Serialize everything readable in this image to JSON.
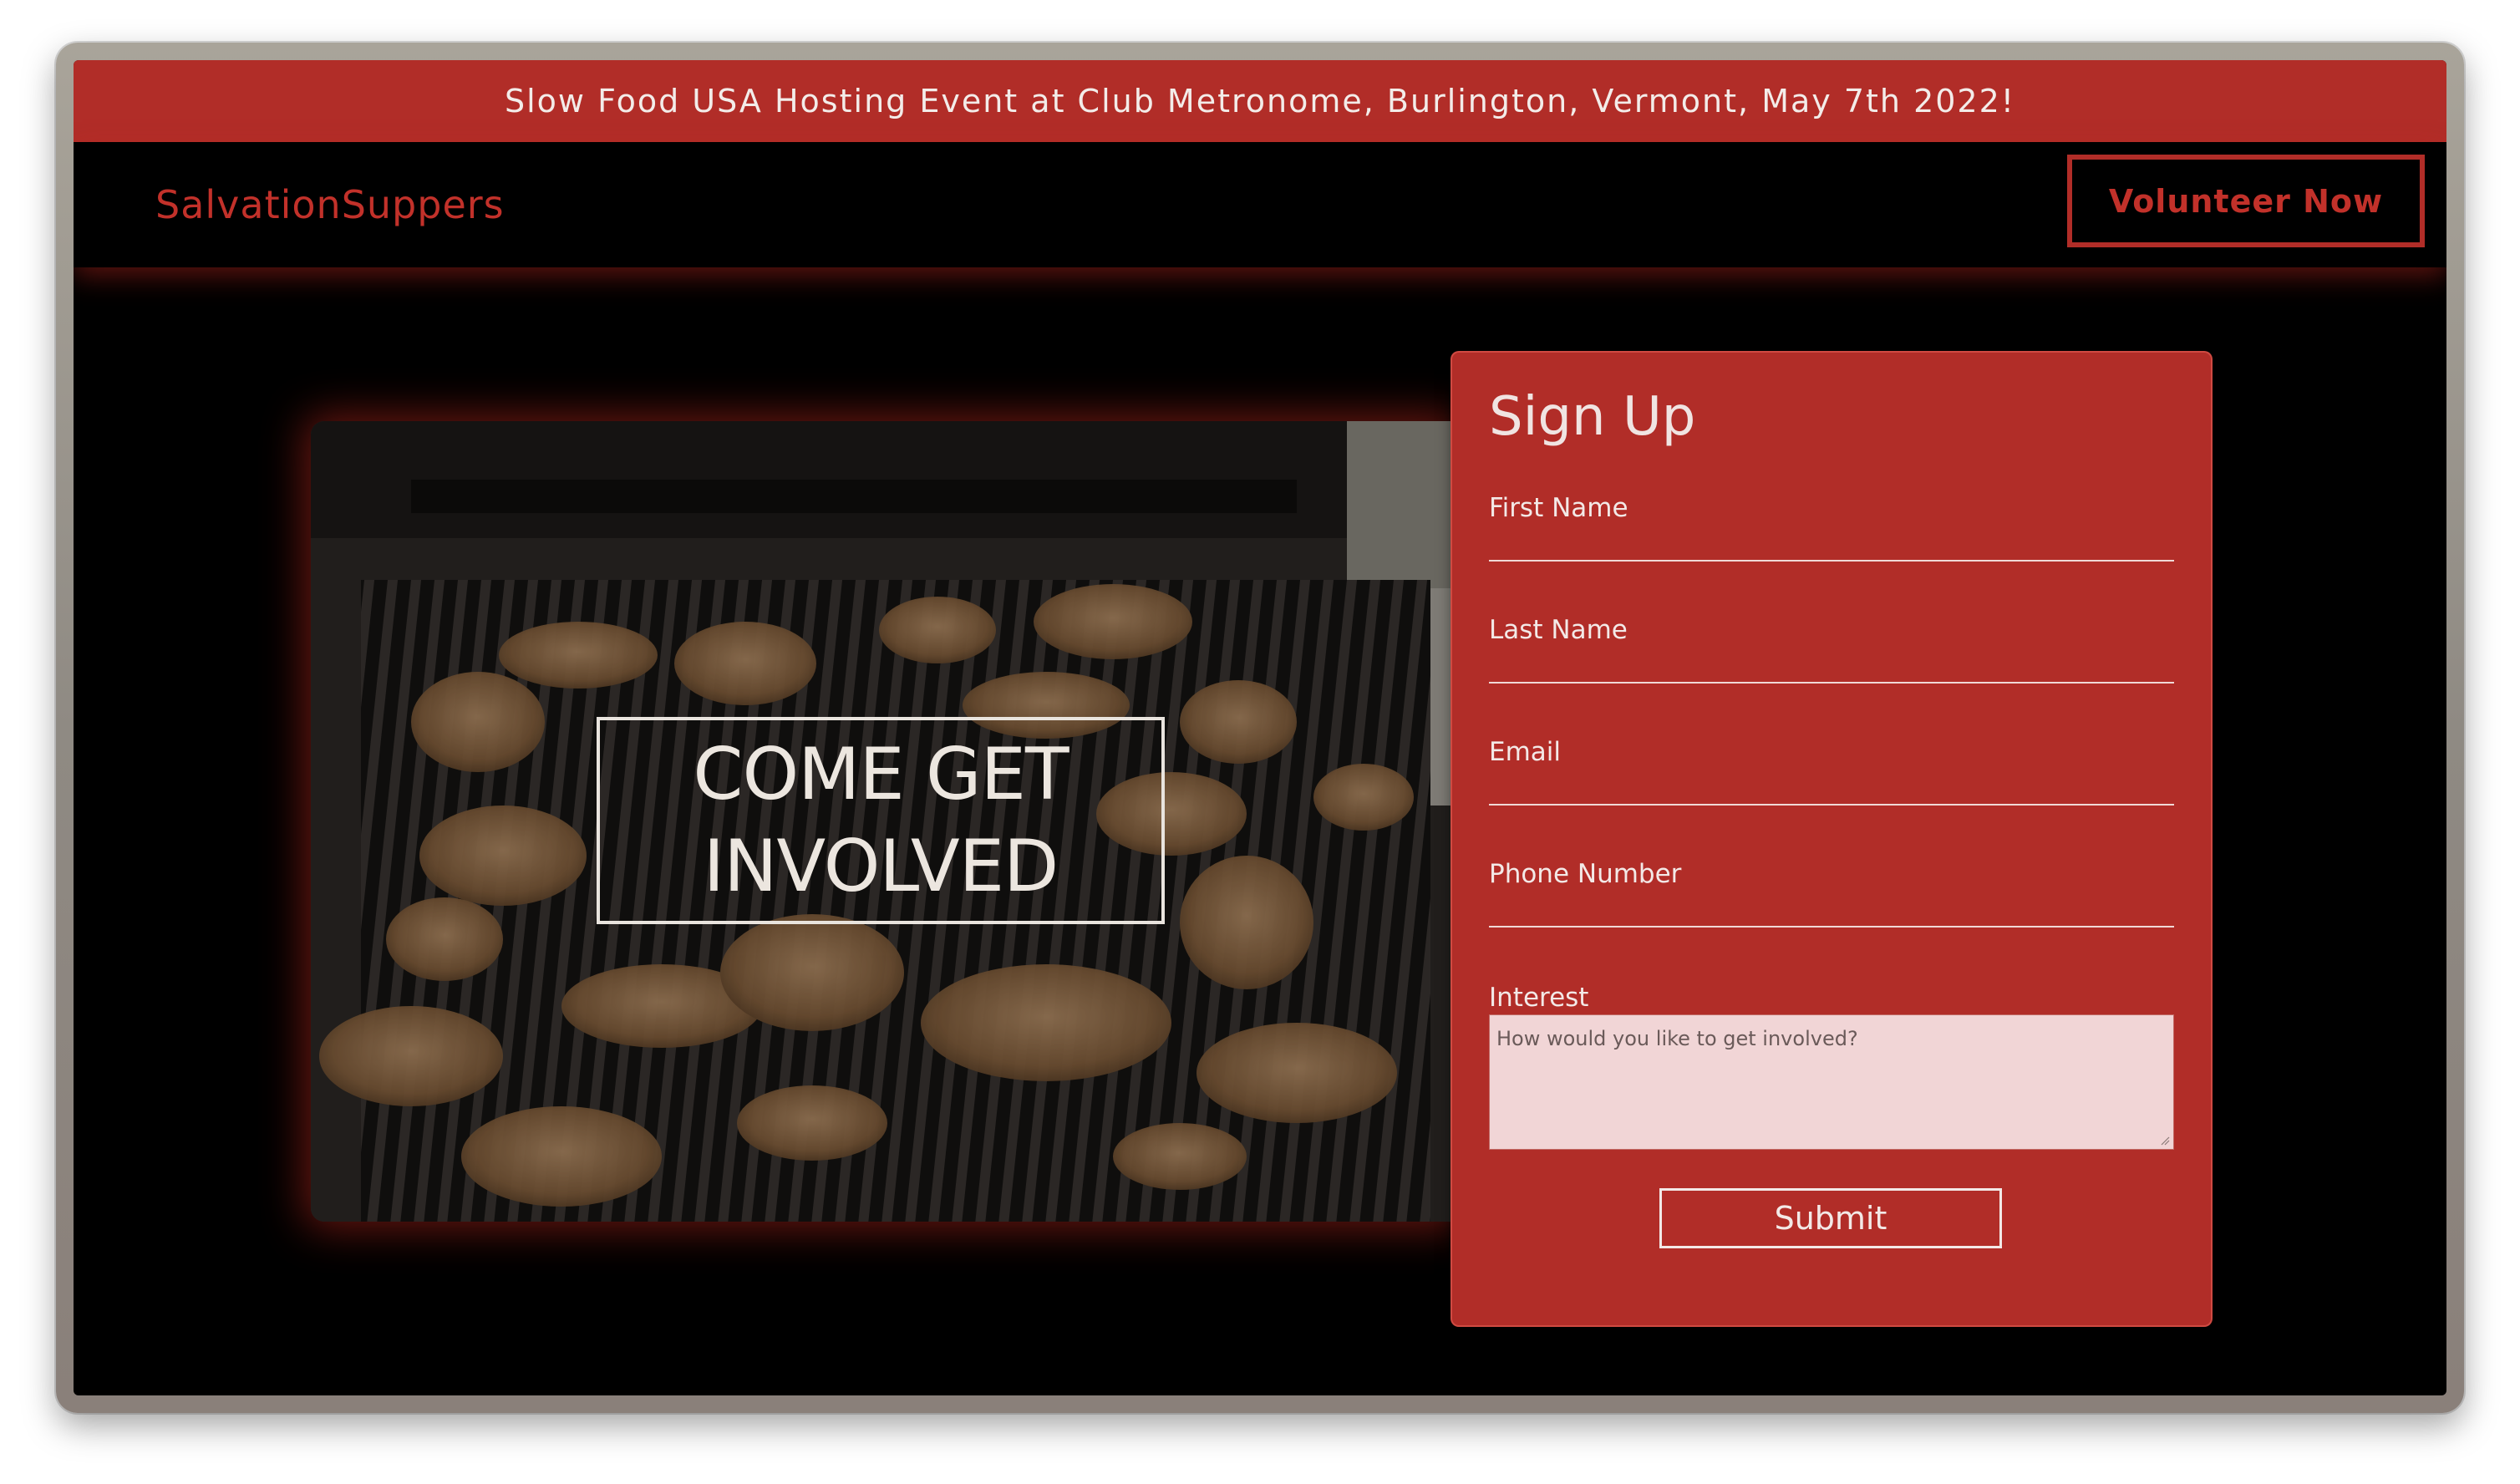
{
  "announcement": {
    "text": "Slow Food USA Hosting Event at Club Metronome, Burlington, Vermont, May 7th 2022!"
  },
  "nav": {
    "brand": "SalvationSuppers",
    "cta_label": "Volunteer Now"
  },
  "hero": {
    "title_line1": "COME GET",
    "title_line2": "INVOLVED"
  },
  "form": {
    "title": "Sign Up",
    "fields": [
      {
        "label": "First Name",
        "value": ""
      },
      {
        "label": "Last Name",
        "value": ""
      },
      {
        "label": "Email",
        "value": ""
      },
      {
        "label": "Phone Number",
        "value": ""
      }
    ],
    "interest": {
      "label": "Interest",
      "placeholder": "How would you like to get involved?"
    },
    "submit_label": "Submit"
  },
  "colors": {
    "accent": "#b12d28",
    "background": "#000000",
    "text_light": "#f3e9e7"
  }
}
